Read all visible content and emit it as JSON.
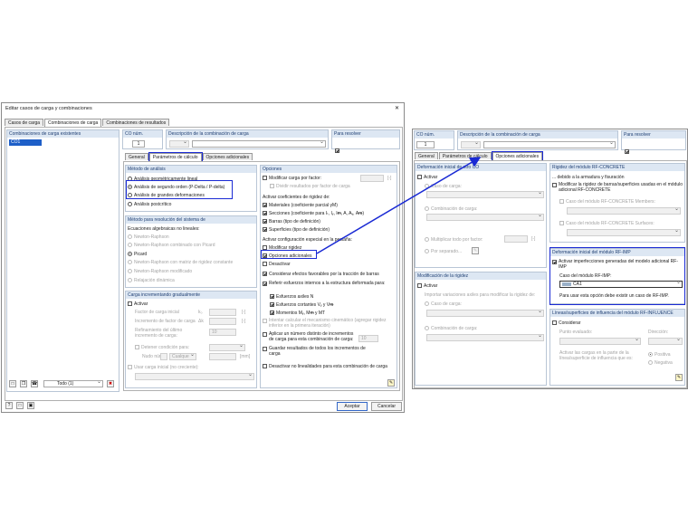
{
  "dialog": {
    "title": "Editar casos de carga y combinaciones",
    "close": "✕",
    "main_tabs": [
      "Casos de carga",
      "Combinaciones de carga",
      "Combinaciones de resultados"
    ],
    "list_header": "Combinaciones de carga existentes",
    "list_items": [
      "CO1"
    ],
    "filter_value": "Todo (1)",
    "co_label": "CO núm.",
    "co_value": "1",
    "desc_label": "Descripción de la combinación de carga",
    "para_resolver": "Para resolver",
    "sub_tabs": [
      "General",
      "Parámetros de cálculo",
      "Opciones adicionales"
    ],
    "metodo": {
      "header": "Método de análisis",
      "options": [
        "Análisis geométricamente lineal",
        "Análisis de segundo orden (P-Delta / P-delta)",
        "Análisis de grandes deformaciones",
        "Análisis postcrítico"
      ]
    },
    "resolucion": {
      "header": "Método para resolución del sistema de",
      "subheader": "Ecuaciones algebraicas no lineales:",
      "options": [
        "Newton-Raphson",
        "Newton-Raphson combinado con Picard",
        "Picard",
        "Newton-Raphson con matriz de rigidez constante",
        "Newton-Raphson modificado",
        "Relajación dinámica"
      ]
    },
    "incremental": {
      "header": "Carga incrementando gradualmente",
      "activar": "Activar",
      "factor_carga": "Factor de carga inicial",
      "factor_sym": "k₀",
      "incremento": "Incremento de factor de carga",
      "incremento_sym": "Δk",
      "refinamiento": "Refinamiento del último incremento de carga:",
      "refinamiento_val": "10",
      "detener": "Detener condición para:",
      "nudo": "Nudo núm.:",
      "nudo_sel": "Cualque",
      "unit_mm": "[mm]",
      "usar_carga": "Usar carga inicial (no creciente):",
      "unit_dash": "[-]"
    },
    "opciones": {
      "header": "Opciones",
      "modificar_carga": "Modificar carga por factor:",
      "dividir": "Dividir resultados por factor de carga",
      "unit": "[-]",
      "activar_coef": "Activar coeficientes de rigidez de:",
      "coef": [
        "Materiales (coeficiente parcial γM)",
        "Secciones (coeficiente para Iₜ, Iᵧ, Iᵯ, A, Aᵧ, Aᵯ)",
        "Barras (tipo de definición)",
        "Superficies (tipo de definición)"
      ],
      "activar_config": "Activar configuración especial en la pestaña:",
      "modificar_rigidez": "Modificar rigidez",
      "opciones_adicionales": "Opciones adicionales",
      "desactivar": "Desactivar",
      "considerar": "Considerar efectos favorables por la tracción de barras",
      "referir": "Referir esfuerzos internos a la estructura deformada para:",
      "esfuerzos": [
        "Esfuerzos axiles N",
        "Esfuerzos cortantes Vᵧ y Vᵯ",
        "Momentos Mᵧ, Mᵯ y MT"
      ],
      "intentar": "Intentar calcular el mecanismo cinemático (agregar rigidez inferior en la primera iteración)",
      "aplicar": "Aplicar un número distinto de incrementos de carga para esta combinación de carga:",
      "aplicar_val": "10",
      "guardar": "Guardar resultados de todos los incrementos de carga",
      "desactivar_nl": "Desactivar no linealidades para esta combinación de carga"
    },
    "aceptar": "Aceptar",
    "cancelar": "Cancelar"
  },
  "panel": {
    "co_label": "CO núm.",
    "co_value": "1",
    "desc_label": "Descripción de la combinación de carga",
    "para_resolver": "Para resolver",
    "sub_tabs": [
      "General",
      "Parámetros de cálculo",
      "Opciones adicionales"
    ],
    "deformacion_inicial": {
      "header": "Deformación inicial de otro CO",
      "activar": "Activar",
      "caso_carga": "Caso de carga:",
      "combinacion": "Combinación de carga:",
      "multiplicar": "Multiplicar todo por factor:",
      "por_separado": "Por separado..."
    },
    "mod_rigidez": {
      "header": "Modificación de la rigidez",
      "activar": "Activar",
      "importar": "Importar variaciones axiles para modificar la rigidez de:",
      "caso_carga": "Caso de carga:",
      "combinacion": "Combinación de carga:"
    },
    "rigidez_concrete": {
      "header": "Rigidez del módulo RF-CONCRETE",
      "debido": "... debido a la armadura y fisuración",
      "modificar": "Modificar la rigidez de barras/superficies usadas en el módulo adicional RF-CONCRETE",
      "members": "Caso del módulo RF-CONCRETE Members:",
      "surfaces": "Caso del módulo RF-CONCRETE Surfaces:"
    },
    "deformacion_imp": {
      "header": "Deformación inicial del módulo RF-IMP",
      "activar": "Activar imperfecciones generadas del modelo adicional RF-IMP",
      "caso": "Caso del módulo RF-IMP:",
      "caso_val": "CA1",
      "nota": "Para usar esta opción debe existir un caso de RF-IMP."
    },
    "lineas": {
      "header": "Líneas/superficies de influencia del módulo RF-INFLUENCE",
      "considerar": "Considerar",
      "punto": "Punto evaluado:",
      "direccion": "Dirección:",
      "activar_cargas": "Activar las cargas en la parte de la línea/superficie de influencia que es:",
      "positiva": "Positiva",
      "negativa": "Negativa"
    }
  }
}
